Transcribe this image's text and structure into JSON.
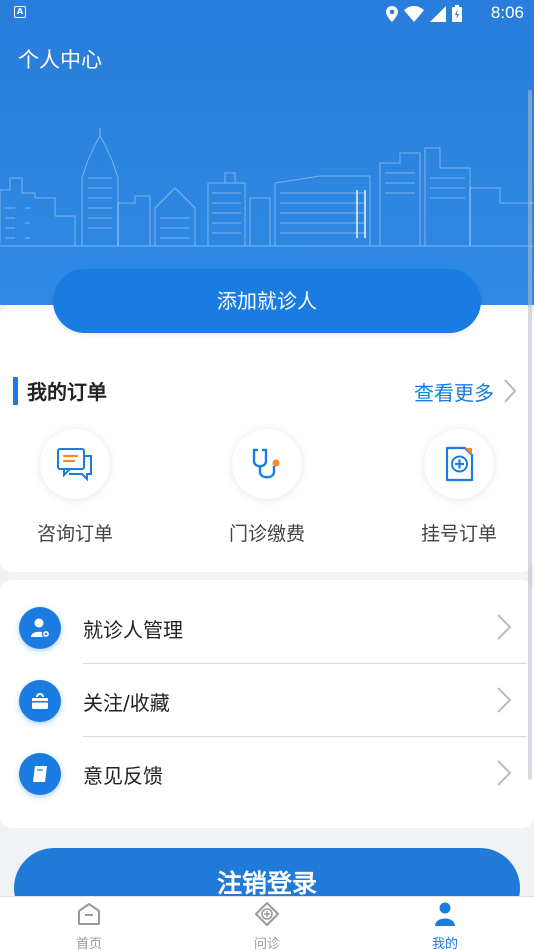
{
  "status_bar": {
    "time": "8:06",
    "notification_icon": "A"
  },
  "header": {
    "title": "个人中心"
  },
  "add_patient_label": "添加就诊人",
  "orders": {
    "title": "我的订单",
    "view_more": "查看更多",
    "items": [
      {
        "label": "咨询订单",
        "icon": "chat-icon"
      },
      {
        "label": "门诊缴费",
        "icon": "stethoscope-icon"
      },
      {
        "label": "挂号订单",
        "icon": "document-plus-icon"
      }
    ]
  },
  "menu": [
    {
      "label": "就诊人管理",
      "icon": "user-settings-icon"
    },
    {
      "label": "关注/收藏",
      "icon": "bag-icon"
    },
    {
      "label": "意见反馈",
      "icon": "feedback-icon"
    }
  ],
  "logout_label": "注销登录",
  "tabs": [
    {
      "label": "首页",
      "icon": "home-icon",
      "active": false
    },
    {
      "label": "问诊",
      "icon": "consult-icon",
      "active": false
    },
    {
      "label": "我的",
      "icon": "profile-icon",
      "active": true
    }
  ],
  "colors": {
    "primary": "#1a7be0",
    "header": "#2a7edb",
    "accent_orange": "#f58a2a"
  }
}
